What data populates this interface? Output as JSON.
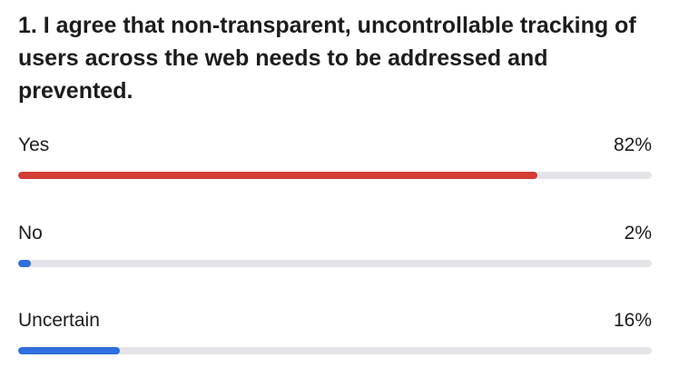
{
  "poll": {
    "question": "1. I agree that non-transparent, uncontrollable tracking of users across the web needs to be addressed and prevented.",
    "options": [
      {
        "label": "Yes",
        "percent_label": "82%",
        "value": 82,
        "color": "#d23c35"
      },
      {
        "label": "No",
        "percent_label": "2%",
        "value": 2,
        "color": "#2f6fdf"
      },
      {
        "label": "Uncertain",
        "percent_label": "16%",
        "value": 16,
        "color": "#2f6fdf"
      }
    ],
    "track_color": "#e4e4e8"
  }
}
